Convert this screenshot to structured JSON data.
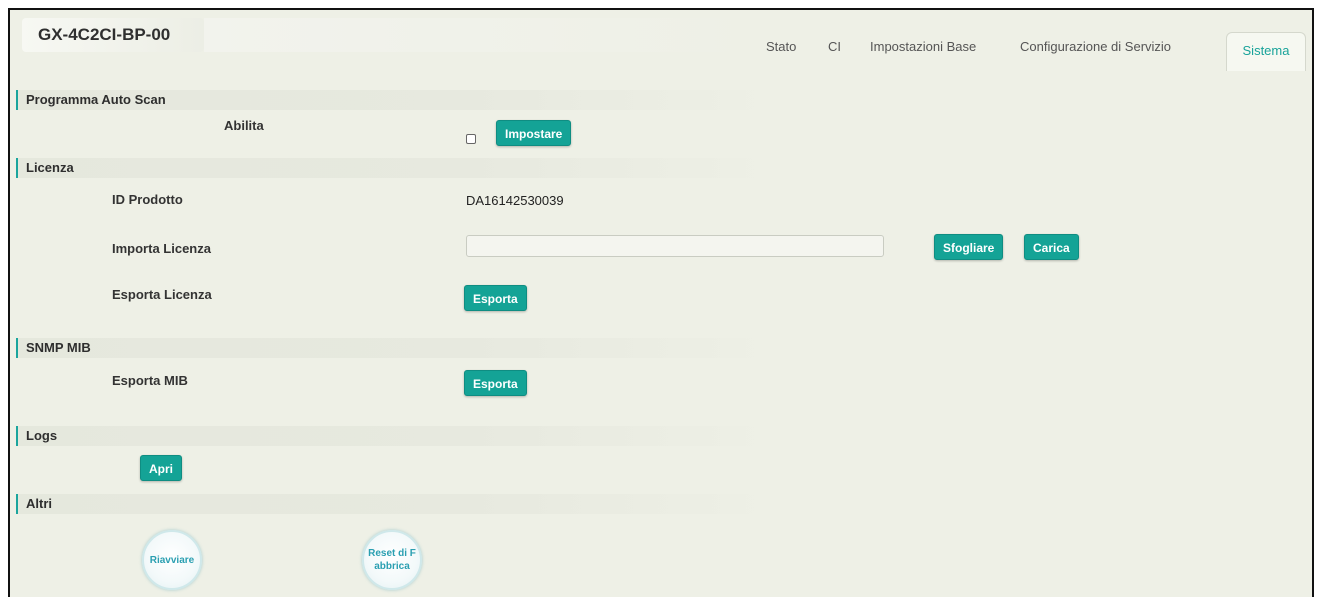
{
  "header": {
    "device_title": "GX-4C2CI-BP-00",
    "tabs": [
      {
        "label": "Stato",
        "active": false
      },
      {
        "label": "CI",
        "active": false
      },
      {
        "label": "Impostazioni Base",
        "active": false
      },
      {
        "label": "Configurazione di Servizio",
        "active": false
      },
      {
        "label": "Sistema",
        "active": true
      }
    ]
  },
  "auto_scan": {
    "section_title": "Programma Auto Scan",
    "enable_label": "Abilita",
    "enabled": false,
    "set_button": "Impostare"
  },
  "license": {
    "section_title": "Licenza",
    "product_id_label": "ID Prodotto",
    "product_id_value": "DA16142530039",
    "import_label": "Importa Licenza",
    "import_value": "",
    "browse_button": "Sfogliare",
    "upload_button": "Carica",
    "export_label": "Esporta Licenza",
    "export_button": "Esporta"
  },
  "snmp": {
    "section_title": "SNMP MIB",
    "export_label": "Esporta MIB",
    "export_button": "Esporta"
  },
  "logs": {
    "section_title": "Logs",
    "open_button": "Apri"
  },
  "others": {
    "section_title": "Altri",
    "restart_button": "Riavviare",
    "factory_reset_button": "Reset di Fabbrica"
  },
  "colors": {
    "accent": "#14a396",
    "active_tab_text": "#19a39a",
    "background": "#eef0e6",
    "circle_text": "#2a9fb1"
  }
}
